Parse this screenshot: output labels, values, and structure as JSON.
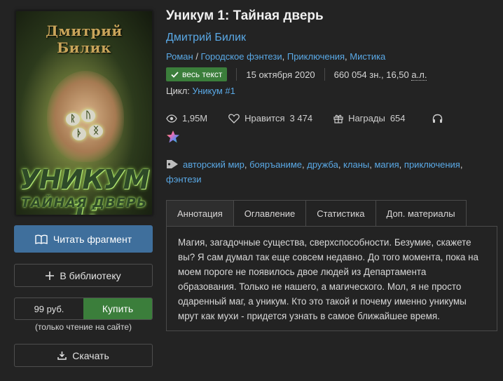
{
  "cover": {
    "author": "Дмитрий Билик",
    "title_line1": "УНИКУМ 1:",
    "title_line2": "ТАЙНАЯ ДВЕРЬ",
    "runes": [
      "ᚱ",
      "ᚢ",
      "ᚦ",
      "ᛝ"
    ]
  },
  "actions": {
    "read_fragment": "Читать фрагмент",
    "add_library": "В библиотеку",
    "price": "99 руб.",
    "buy": "Купить",
    "buy_note": "(только чтение на сайте)",
    "download": "Скачать"
  },
  "book": {
    "title": "Уникум 1: Тайная дверь",
    "author": "Дмитрий Билик",
    "genres": [
      "Роман",
      "Городское фэнтези",
      "Приключения",
      "Мистика"
    ],
    "status_badge": "весь текст",
    "date": "15 октября 2020",
    "size": "660 054 зн., 16,50",
    "size_unit": "а.л.",
    "cycle_label": "Цикл:",
    "cycle_value": "Уникум #1"
  },
  "stats": {
    "views": "1,95М",
    "likes_label": "Нравится",
    "likes": "3 474",
    "awards_label": "Награды",
    "awards": "654"
  },
  "tags": [
    "авторский мир",
    "бояръаниме",
    "дружба",
    "кланы",
    "магия",
    "приключения",
    "фэнтези"
  ],
  "tabs": [
    "Аннотация",
    "Оглавление",
    "Статистика",
    "Доп. материалы"
  ],
  "annotation": "Магия, загадочные существа, сверхспособности. Безумие, скажете вы? Я сам думал так еще совсем недавно. До того момента, пока на моем пороге не появилось двое людей из Департамента образования. Только не нашего, а магического. Мол, я не просто одаренный маг, а уникум. Кто это такой и почему именно уникумы мрут как мухи - придется узнать в самое ближайшее время.",
  "colors": {
    "background": "#232323",
    "link": "#5aa9e6",
    "primary_button": "#3f6f9c",
    "buy_button": "#3b7e3b"
  }
}
